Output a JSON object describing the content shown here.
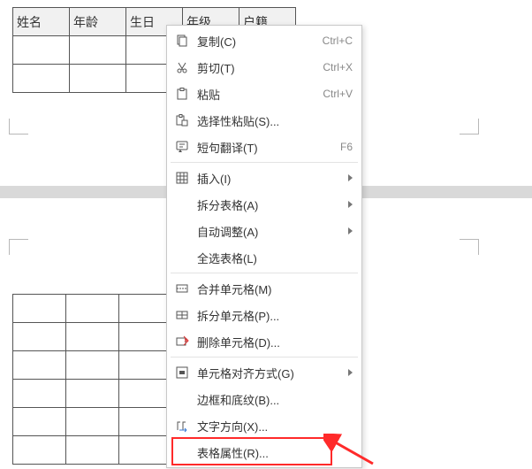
{
  "table": {
    "headers": [
      "姓名",
      "年龄",
      "生日",
      "年级",
      "户籍"
    ],
    "bodyRows": 2,
    "cellsPerRow": 5
  },
  "lowerGrid": {
    "rows": 6,
    "cols": 3
  },
  "menu": {
    "groups": [
      [
        {
          "icon": "copy-icon",
          "label": "复制(C)",
          "shortcut": "Ctrl+C",
          "submenu": false
        },
        {
          "icon": "cut-icon",
          "label": "剪切(T)",
          "shortcut": "Ctrl+X",
          "submenu": false
        },
        {
          "icon": "paste-icon",
          "label": "粘贴",
          "shortcut": "Ctrl+V",
          "submenu": false
        },
        {
          "icon": "paste-special-icon",
          "label": "选择性粘贴(S)...",
          "shortcut": "",
          "submenu": false
        },
        {
          "icon": "translate-icon",
          "label": "短句翻译(T)",
          "shortcut": "F6",
          "submenu": false
        }
      ],
      [
        {
          "icon": "insert-icon",
          "label": "插入(I)",
          "shortcut": "",
          "submenu": true
        },
        {
          "icon": "",
          "label": "拆分表格(A)",
          "shortcut": "",
          "submenu": true
        },
        {
          "icon": "",
          "label": "自动调整(A)",
          "shortcut": "",
          "submenu": true
        },
        {
          "icon": "",
          "label": "全选表格(L)",
          "shortcut": "",
          "submenu": false
        }
      ],
      [
        {
          "icon": "merge-icon",
          "label": "合并单元格(M)",
          "shortcut": "",
          "submenu": false
        },
        {
          "icon": "split-icon",
          "label": "拆分单元格(P)...",
          "shortcut": "",
          "submenu": false
        },
        {
          "icon": "delete-cell-icon",
          "label": "删除单元格(D)...",
          "shortcut": "",
          "submenu": false
        }
      ],
      [
        {
          "icon": "align-icon",
          "label": "单元格对齐方式(G)",
          "shortcut": "",
          "submenu": true
        },
        {
          "icon": "",
          "label": "边框和底纹(B)...",
          "shortcut": "",
          "submenu": false
        },
        {
          "icon": "text-dir-icon",
          "label": "文字方向(X)...",
          "shortcut": "",
          "submenu": false
        },
        {
          "icon": "",
          "label": "表格属性(R)...",
          "shortcut": "",
          "submenu": false
        }
      ]
    ]
  },
  "annot": {
    "highlightGroup": 3,
    "highlightIndex": 3
  }
}
